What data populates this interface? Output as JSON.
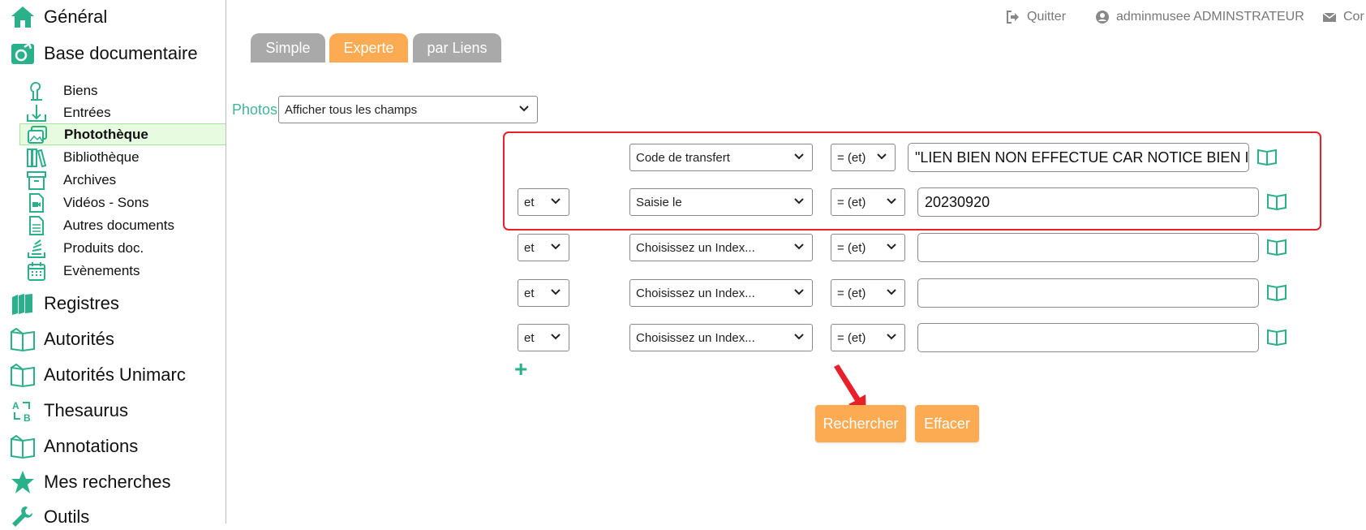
{
  "sidebar": {
    "top_items": [
      {
        "label": "Général",
        "icon": "home-icon"
      },
      {
        "label": "Base documentaire",
        "icon": "document-base-icon"
      }
    ],
    "sub_items": [
      {
        "label": "Biens",
        "icon": "object-icon"
      },
      {
        "label": "Entrées",
        "icon": "inbox-download-icon"
      },
      {
        "label": "Photothèque",
        "icon": "photos-icon",
        "active": true
      },
      {
        "label": "Bibliothèque",
        "icon": "books-icon"
      },
      {
        "label": "Archives",
        "icon": "archive-box-icon"
      },
      {
        "label": "Vidéos - Sons",
        "icon": "video-file-icon"
      },
      {
        "label": "Autres documents",
        "icon": "document-icon"
      },
      {
        "label": "Produits doc.",
        "icon": "stack-icon"
      },
      {
        "label": "Evènements",
        "icon": "calendar-icon"
      }
    ],
    "bottom_items": [
      {
        "label": "Registres",
        "icon": "registers-icon"
      },
      {
        "label": "Autorités",
        "icon": "open-book-icon"
      },
      {
        "label": "Autorités Unimarc",
        "icon": "open-book-icon"
      },
      {
        "label": "Thesaurus",
        "icon": "thesaurus-icon"
      },
      {
        "label": "Annotations",
        "icon": "open-book-icon"
      },
      {
        "label": "Mes recherches",
        "icon": "star-icon"
      },
      {
        "label": "Outils",
        "icon": "wrench-icon"
      }
    ]
  },
  "topbar": {
    "quit_label": "Quitter",
    "user_label": "adminmusee ADMINSTRATEUR",
    "contact_label": "Cor"
  },
  "tabs": [
    {
      "label": "Simple"
    },
    {
      "label": "Experte"
    },
    {
      "label": "par Liens"
    }
  ],
  "search": {
    "base_label": "Photos",
    "display_select": "Afficher tous les champs",
    "rows": [
      {
        "connector": "",
        "index": "Code de transfert",
        "operator": "= (et)",
        "value": "\"LIEN BIEN NON EFFECTUE CAR NOTICE BIEN IN"
      },
      {
        "connector": "et",
        "index": "Saisie le",
        "operator": "= (et)",
        "value": "20230920"
      },
      {
        "connector": "et",
        "index": "Choisissez un Index...",
        "operator": "= (et)",
        "value": ""
      },
      {
        "connector": "et",
        "index": "Choisissez un Index...",
        "operator": "= (et)",
        "value": ""
      },
      {
        "connector": "et",
        "index": "Choisissez un Index...",
        "operator": "= (et)",
        "value": ""
      }
    ],
    "add_row": "+",
    "search_button": "Rechercher",
    "clear_button": "Effacer"
  },
  "colors": {
    "accent_orange": "#fcab52",
    "tab_grey": "#a9a9a9",
    "icon_green": "#2bb08c",
    "highlight_red": "#e8202a"
  }
}
